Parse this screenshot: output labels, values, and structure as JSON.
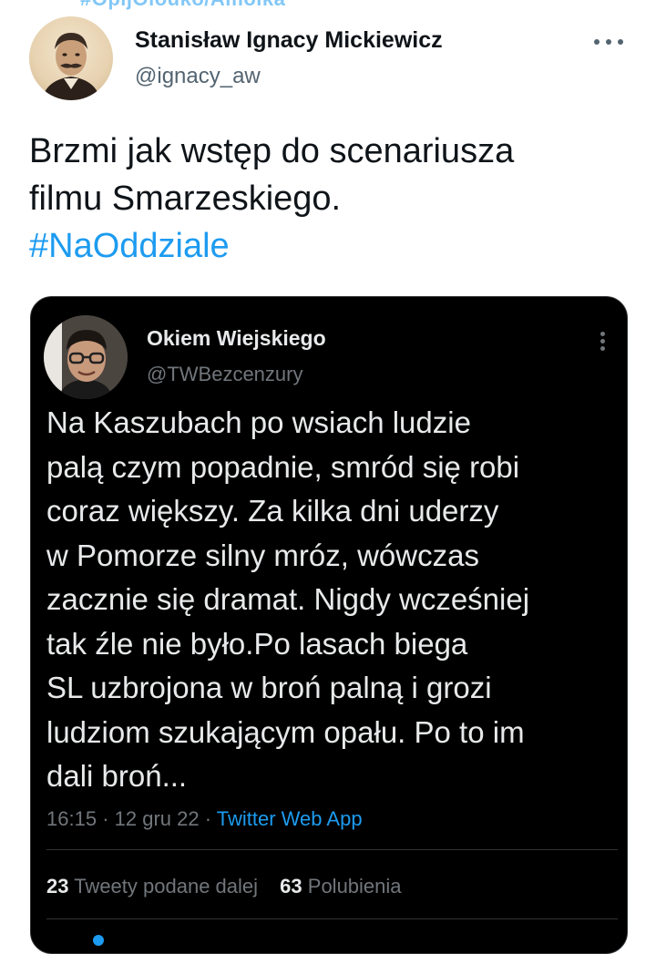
{
  "top_hashtag_partial": "#OpljOlouko/Amolka",
  "author": {
    "name": "Stanisław Ignacy Mickiewicz",
    "handle": "@ignacy_aw"
  },
  "tweet": {
    "lines": [
      "Brzmi jak wstęp do scenariusza",
      "filmu Smarzeskiego."
    ],
    "hashtag": "#NaOddziale"
  },
  "quoted": {
    "name": "Okiem Wiejskiego",
    "handle": "@TWBezcenzury",
    "lines": [
      "Na Kaszubach po wsiach ludzie",
      "palą czym popadnie, smród się robi",
      "coraz większy. Za kilka dni uderzy",
      "w Pomorze silny mróz, wówczas",
      "zacznie się dramat. Nigdy wcześniej",
      "tak źle nie było.Po lasach biega",
      "SL uzbrojona w broń palną i grozi",
      "ludziom szukającym opału. Po to im",
      "dali broń..."
    ],
    "time": "16:15",
    "date": "12 gru 22",
    "source": "Twitter Web App",
    "retweets_count": "23",
    "retweets_label": "Tweety podane dalej",
    "likes_count": "63",
    "likes_label": "Polubienia"
  },
  "icons": [
    "more-horizontal-icon",
    "more-vertical-icon"
  ],
  "colors": {
    "accent": "#1d9bf0",
    "text": "#0f1419",
    "muted": "#536471",
    "dark_bg": "#000000"
  }
}
